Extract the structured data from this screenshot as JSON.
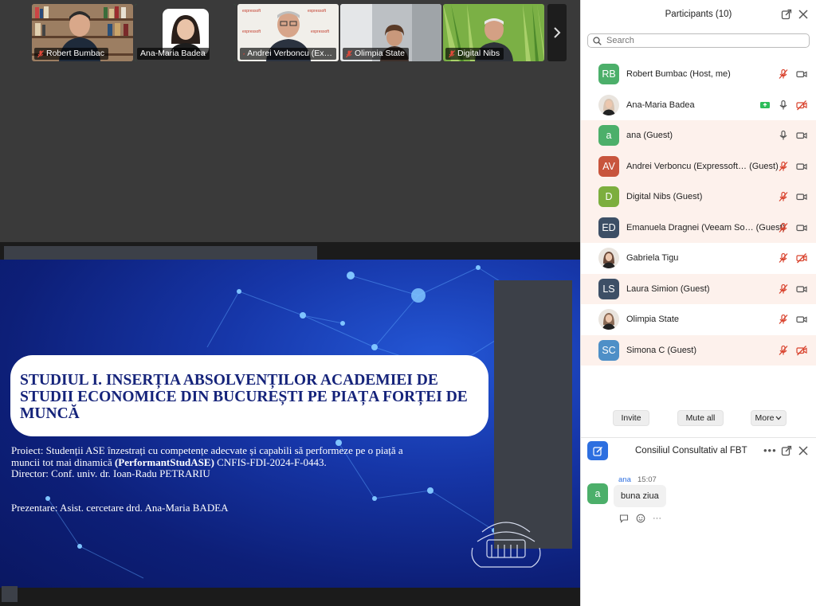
{
  "video_strip": {
    "tiles": [
      {
        "name": "Robert Bumbac",
        "muted": true
      },
      {
        "name": "Ana-Maria Badea",
        "muted": false
      },
      {
        "name": "Andrei Verboncu (Ex…",
        "muted": true
      },
      {
        "name": "Olimpia State",
        "muted": true
      },
      {
        "name": "Digital Nibs",
        "muted": true
      }
    ],
    "tile_logo_text": "expressoft",
    "next_icon": "chevron-right-icon"
  },
  "slide": {
    "title": "STUDIUL I. INSERȚIA ABSOLVENȚILOR ACADEMIEI DE STUDII ECONOMICE DIN BUCUREȘTI PE PIAȚA FORȚEI DE MUNCĂ",
    "body_pre": "Proiect: Studenții ASE înzestrați cu competențe adecvate și capabili să performeze pe o piață a muncii tot mai dinamică ",
    "body_bold": "(PerformantStudASE)",
    "body_post": " CNFIS-FDI-2024-F-0443.",
    "director": "Director: Conf. univ. dr. Ioan-Radu PETRARIU",
    "presenter": "Prezentare: Asist. cercetare drd. Ana-Maria BADEA"
  },
  "participants": {
    "title": "Participants (10)",
    "search_placeholder": "Search",
    "list": [
      {
        "name": "Robert Bumbac (Host, me)",
        "initials": "RB",
        "color": "#4caf6a",
        "guest": false,
        "mic": "off",
        "video": "on",
        "share": false
      },
      {
        "name": "Ana-Maria Badea",
        "initials": "",
        "color": "#d9c3b0",
        "guest": false,
        "mic": "on",
        "video": "off",
        "share": true
      },
      {
        "name": "ana (Guest)",
        "initials": "a",
        "color": "#4caf6a",
        "guest": true,
        "mic": "on",
        "video": "on",
        "share": false
      },
      {
        "name": "Andrei Verboncu (Expressoft…   (Guest)",
        "initials": "AV",
        "color": "#c8553d",
        "guest": true,
        "mic": "off",
        "video": "on",
        "share": false
      },
      {
        "name": "Digital Nibs (Guest)",
        "initials": "D",
        "color": "#7cae3e",
        "guest": true,
        "mic": "off",
        "video": "on",
        "share": false
      },
      {
        "name": "Emanuela Dragnei (Veeam So…   (Guest)",
        "initials": "ED",
        "color": "#3d4f66",
        "guest": true,
        "mic": "off",
        "video": "on",
        "share": false
      },
      {
        "name": "Gabriela Tigu",
        "initials": "",
        "color": "#6b4a3a",
        "guest": false,
        "mic": "off",
        "video": "off",
        "share": false
      },
      {
        "name": "Laura Simion (Guest)",
        "initials": "LS",
        "color": "#3d4f66",
        "guest": true,
        "mic": "off",
        "video": "on",
        "share": false
      },
      {
        "name": "Olimpia State",
        "initials": "",
        "color": "#8a6a55",
        "guest": false,
        "mic": "off",
        "video": "on",
        "share": false
      },
      {
        "name": "Simona C (Guest)",
        "initials": "SC",
        "color": "#4e8fc7",
        "guest": true,
        "mic": "off",
        "video": "off",
        "share": false
      }
    ],
    "invite_label": "Invite",
    "mute_all_label": "Mute all",
    "more_label": "More"
  },
  "chat": {
    "title": "Consiliul Consultativ al FBT",
    "message": {
      "sender": "ana",
      "initial": "a",
      "time": "15:07",
      "text": "buna ziua"
    }
  },
  "colors": {
    "accent": "#2d6fe0",
    "muted_red": "#d9442f",
    "active_green": "#2dbd5a",
    "guest_row": "#fdf1ec"
  }
}
